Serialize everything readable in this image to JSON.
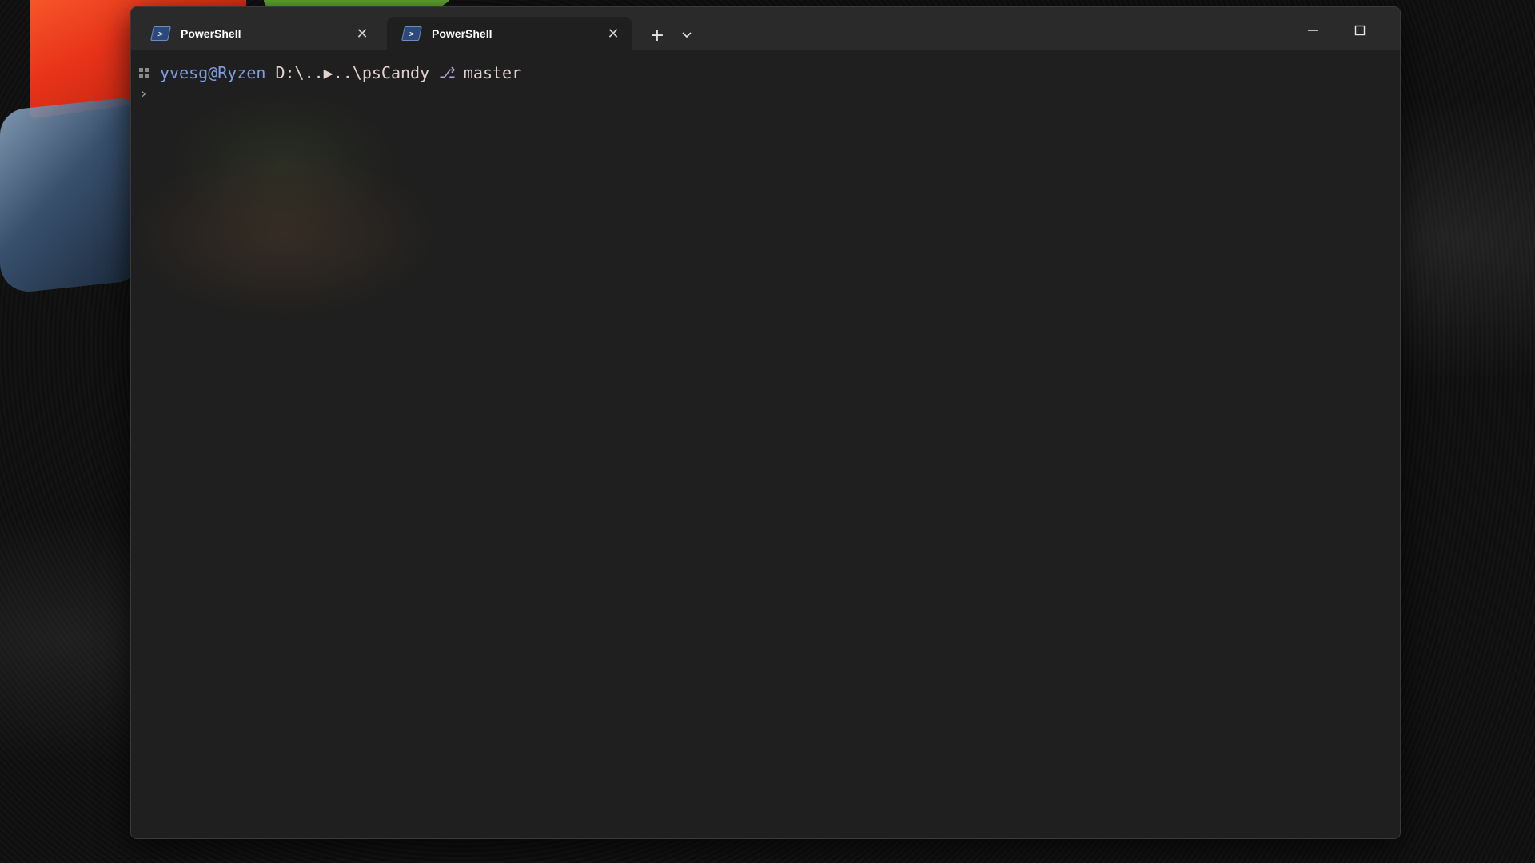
{
  "window": {
    "tabs": [
      {
        "label": "PowerShell",
        "icon": "powershell-icon",
        "active": false,
        "close_glyph": "✕"
      },
      {
        "label": "PowerShell",
        "icon": "powershell-icon",
        "active": true,
        "close_glyph": "✕"
      }
    ],
    "new_tab_glyph": "+",
    "dropdown_glyph": "⌄"
  },
  "terminal": {
    "prompt": {
      "user_host": "yvesg@Ryzen",
      "path": "D:\\..▶..\\psCandy",
      "branch_glyph": "⎇",
      "branch": "master"
    },
    "cursor_glyph": "›"
  },
  "colors": {
    "terminal_bg": "#1f1f1f",
    "titlebar_bg": "#2a2a2a",
    "user_host": "#7f9ee0",
    "path": "#e3d2d2"
  }
}
